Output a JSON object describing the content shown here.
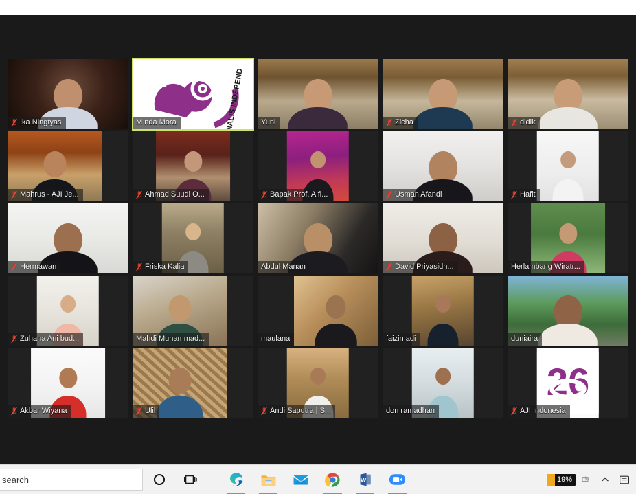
{
  "window": {
    "app": "Zoom",
    "view": "gallery-view"
  },
  "meeting": {
    "active_speaker": "M nda Mora",
    "tiles": [
      {
        "name": "Ika Ningtyas",
        "muted": true,
        "speaking": false,
        "fit": "full",
        "bg": "radial-gradient(circle at 52% 40%, #6b4a3a 0%, #3a2118 46%, #140c08 100%)",
        "skin": "#c08f6e",
        "shirt": "#cfd6e2"
      },
      {
        "name": "M nda Mora",
        "muted": false,
        "speaking": true,
        "fit": "full",
        "bg": "linear-gradient(160deg,#f4f4f4 0%,#efeaf2 45%,#ffffff 100%)",
        "logo": "aji-bird-logo"
      },
      {
        "name": "Yuni",
        "muted": false,
        "speaking": false,
        "fit": "full",
        "bg": "linear-gradient(180deg,#9a7a4c 0%,#6e5330 26%,#b9a98c 60%,#8b7e66 100%)",
        "skin": "#c79a75",
        "shirt": "#3a2a3c"
      },
      {
        "name": "Zicha",
        "muted": true,
        "speaking": false,
        "fit": "full",
        "bg": "linear-gradient(180deg,#9d7b4e 0%,#7a5c34 26%,#c5b79b 60%,#94876d 100%)",
        "skin": "#c69a74",
        "shirt": "#1d3a52"
      },
      {
        "name": "didik",
        "muted": true,
        "speaking": false,
        "fit": "full",
        "bg": "linear-gradient(180deg,#a07f50 0%,#7d5f36 24%,#cabba0 58%,#9b8e74 100%)",
        "skin": "#c89c76",
        "shirt": "#e8e6e0"
      },
      {
        "name": "Mahrus - AJI Je...",
        "muted": true,
        "speaking": false,
        "fit": "inset-wide",
        "bg": "linear-gradient(180deg,#b5581f 0%,#8e4216 30%,#c9a06a 62%,#8e7a55 100%)",
        "skin": "#b9845c",
        "shirt": "#14161c"
      },
      {
        "name": "Ahmad Suudi O...",
        "muted": true,
        "speaking": false,
        "fit": "inset",
        "bg": "linear-gradient(180deg,#7a2d1c 0%,#59211a 34%,#b08f6f 66%,#5d4a3c 100%)",
        "skin": "#c2977a",
        "shirt": "#5c2b3c"
      },
      {
        "name": "Bapak Prof. Alfi...",
        "muted": true,
        "speaking": false,
        "fit": "inset-sm",
        "bg": "linear-gradient(175deg,#b6258f 0%,#8c1f7f 38%,#c23a55 72%,#d44a3d 100%)",
        "skin": "#c1946f",
        "shirt": "#1a1a1e"
      },
      {
        "name": "Usman Afandi",
        "muted": true,
        "speaking": false,
        "fit": "full",
        "bg": "linear-gradient(180deg,#f1f0ee 0%,#e4e3e1 48%,#cfcdc9 100%)",
        "skin": "#b2835f",
        "shirt": "#17171b"
      },
      {
        "name": "Hafit",
        "muted": true,
        "speaking": false,
        "fit": "inset-sm",
        "bg": "linear-gradient(180deg,#f7f7f7 0%,#ededed 60%,#e2e2e2 100%)",
        "skin": "#c49b7c",
        "shirt": "#f3f3f3"
      },
      {
        "name": "Hermawan",
        "muted": true,
        "speaking": false,
        "fit": "full",
        "bg": "linear-gradient(180deg,#f4f4f2 0%,#e9e9e6 50%,#d8d8d4 100%)",
        "skin": "#9c6f4f",
        "shirt": "#141418"
      },
      {
        "name": "Friska Kalia",
        "muted": true,
        "speaking": false,
        "fit": "inset-sm",
        "bg": "linear-gradient(180deg,#b9ab8a 0%,#8e8164 40%,#6b5f47 100%)",
        "skin": "#d9b58c",
        "shirt": "#8d8a84"
      },
      {
        "name": "Abdul Manan",
        "muted": false,
        "speaking": false,
        "fit": "full",
        "bg": "linear-gradient(120deg,#cdbfa6 0%,#8a7b63 38%,#2c2a28 72%,#151414 100%)",
        "skin": "#b98f68",
        "shirt": "#1c1c20"
      },
      {
        "name": "David Priyasidh...",
        "muted": true,
        "speaking": false,
        "fit": "full",
        "bg": "linear-gradient(180deg,#efece6 0%,#e2ded6 52%,#cdc7bd 100%)",
        "skin": "#8c6144",
        "shirt": "#2a1c1a"
      },
      {
        "name": "Herlambang Wiratr...",
        "muted": false,
        "speaking": false,
        "fit": "inset",
        "bg": "linear-gradient(180deg,#5f8d4e 0%,#4a7a3e 44%,#8fb87a 100%)",
        "skin": "#c49a74",
        "shirt": "#cf3b62"
      },
      {
        "name": "Zuhana Ani bud...",
        "muted": true,
        "speaking": false,
        "fit": "inset-sm",
        "bg": "linear-gradient(180deg,#f3f1ec 0%,#e7e4dd 50%,#d7d3ca 100%)",
        "skin": "#d8ac87",
        "shirt": "#efb8a6"
      },
      {
        "name": "Mahdi Muhammad...",
        "muted": false,
        "speaking": false,
        "fit": "inset-wide",
        "bg": "linear-gradient(160deg,#d9d4ca 0%,#b9a98c 44%,#8a7356 100%)",
        "skin": "#c2996f",
        "shirt": "#2f4f42"
      },
      {
        "name": "maulana",
        "muted": false,
        "speaking": false,
        "fit": "inset-right",
        "bg": "linear-gradient(135deg,#e0c392 0%,#b9905c 42%,#7d5f38 100%)",
        "skin": "#9a7350",
        "shirt": "#1a1a1e"
      },
      {
        "name": "faizin adi",
        "muted": false,
        "speaking": false,
        "fit": "inset-sm",
        "bg": "linear-gradient(170deg,#c9a26a 0%,#9c7a46 40%,#584430 100%)",
        "skin": "#a8785a",
        "shirt": "#17212e"
      },
      {
        "name": "duniaira",
        "muted": false,
        "speaking": false,
        "fit": "full",
        "bg": "linear-gradient(180deg,#7fb4d8 0%,#5c9a5a 40%,#3d6c3a 70%,#6f7c62 100%)",
        "skin": "#8e6346",
        "shirt": "#efe9e2"
      },
      {
        "name": "Akbar Wiyana",
        "muted": true,
        "speaking": false,
        "fit": "inset",
        "bg": "linear-gradient(180deg,#fbfbfb 0%,#f2f2f2 60%,#e6e6e6 100%)",
        "skin": "#b07a55",
        "shirt": "#d62f2a"
      },
      {
        "name": "Ulil",
        "muted": true,
        "speaking": false,
        "fit": "inset-wide",
        "bg": "repeating-linear-gradient(42deg,#c8a577 0px,#c8a577 5px,#9a7a4c 5px,#9a7a4c 10px)",
        "skin": "#a97c58",
        "shirt": "#2f5f88"
      },
      {
        "name": "Andi Saputra | S...",
        "muted": true,
        "speaking": false,
        "fit": "inset-sm",
        "bg": "linear-gradient(180deg,#d8b281 0%,#b08c57 44%,#8a6c40 100%)",
        "skin": "#a87a56",
        "shirt": "#f0efeb"
      },
      {
        "name": "don ramadhan",
        "muted": false,
        "speaking": false,
        "fit": "inset-sm",
        "bg": "linear-gradient(180deg,#e8eef0 0%,#d5dde0 48%,#b9c4c6 100%)",
        "skin": "#9d7050",
        "shirt": "#9fc6cf"
      },
      {
        "name": "AJI Indonesia",
        "muted": true,
        "speaking": false,
        "fit": "inset-sm",
        "bg": "linear-gradient(180deg,#ffffff 0%,#fbfbfb 100%)",
        "logo": "aji-26-logo"
      }
    ]
  },
  "taskbar": {
    "search_value": "search",
    "search_placeholder": "Type here to search",
    "icons": [
      {
        "name": "cortana-icon",
        "label": "Cortana"
      },
      {
        "name": "task-view-icon",
        "label": "Task View"
      },
      {
        "name": "edge-icon",
        "label": "Microsoft Edge"
      },
      {
        "name": "file-explorer-icon",
        "label": "File Explorer"
      },
      {
        "name": "mail-icon",
        "label": "Mail"
      },
      {
        "name": "chrome-icon",
        "label": "Google Chrome"
      },
      {
        "name": "word-icon",
        "label": "Microsoft Word"
      },
      {
        "name": "zoom-icon",
        "label": "Zoom"
      }
    ],
    "tray": {
      "battery_percent": "19%",
      "battery_color": "#f0a81e",
      "items": [
        "battery-icon",
        "show-hidden-icons-icon",
        "action-center-icon"
      ]
    }
  }
}
